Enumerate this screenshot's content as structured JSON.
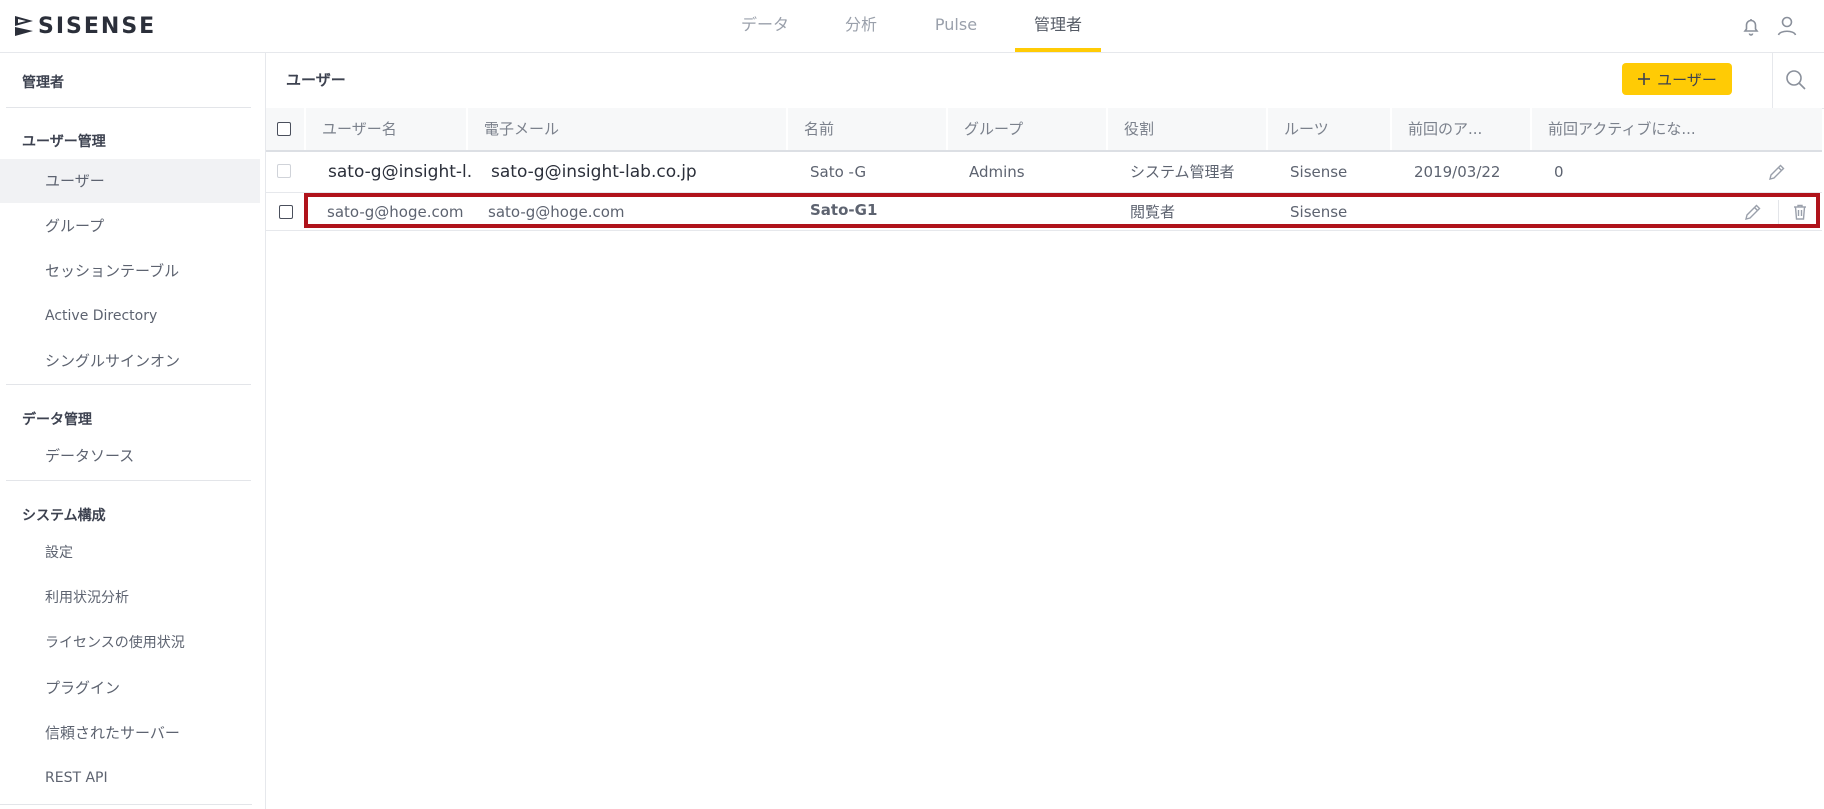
{
  "brand": {
    "name": "SISENSE"
  },
  "nav": {
    "items": [
      {
        "label": "データ",
        "active": false
      },
      {
        "label": "分析",
        "active": false
      },
      {
        "label": "Pulse",
        "active": false
      },
      {
        "label": "管理者",
        "active": true
      }
    ],
    "accent_color": "#ffcb05"
  },
  "top_icons": [
    "bell-icon",
    "user-icon"
  ],
  "sidebar": {
    "title": "管理者",
    "sections": [
      {
        "header": "ユーザー管理",
        "items": [
          "ユーザー",
          "グループ",
          "セッションテーブル",
          "Active Directory",
          "シングルサインオン"
        ]
      },
      {
        "header": "データ管理",
        "items": [
          "データソース"
        ]
      },
      {
        "header": "システム構成",
        "items": [
          "設定",
          "利用状況分析",
          "ライセンスの使用状況",
          "プラグイン",
          "信頼されたサーバー",
          "REST API"
        ]
      }
    ],
    "active_item": "ユーザー"
  },
  "main": {
    "title": "ユーザー",
    "add_button_label": "ユーザー",
    "add_button_icon": "plus-icon",
    "search_icon": "search-icon"
  },
  "table": {
    "columns": [
      "ユーザー名",
      "電子メール",
      "名前",
      "グループ",
      "役割",
      "ルーツ",
      "前回のア...",
      "前回アクティブにな..."
    ],
    "rows": [
      {
        "username": "sato-g@insight-l...",
        "email": "sato-g@insight-lab.co.jp",
        "name": "Sato -G",
        "group": "Admins",
        "role": "システム管理者",
        "roots": "Sisense",
        "last_login": "2019/03/22",
        "last_active": "0"
      },
      {
        "username": "sato-g@hoge.com",
        "email": "sato-g@hoge.com",
        "name": "Sato-G1",
        "group": "",
        "role": "閲覧者",
        "roots": "Sisense",
        "last_login": "",
        "last_active": ""
      }
    ]
  },
  "highlight_color": "#b0131b"
}
